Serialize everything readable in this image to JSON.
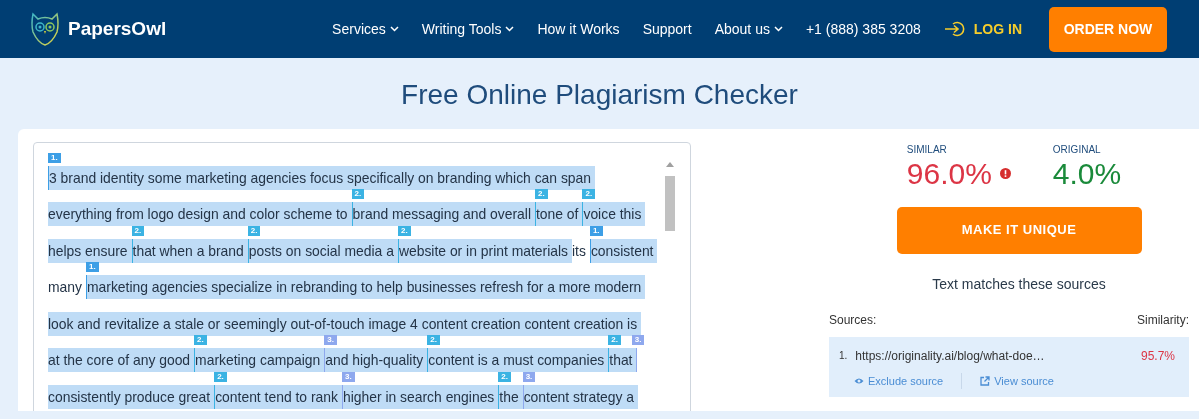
{
  "header": {
    "brand": "PapersOwl",
    "nav": [
      {
        "label": "Services",
        "dropdown": true
      },
      {
        "label": "Writing Tools",
        "dropdown": true
      },
      {
        "label": "How it Works",
        "dropdown": false
      },
      {
        "label": "Support",
        "dropdown": false
      },
      {
        "label": "About us",
        "dropdown": true
      },
      {
        "label": "+1 (888) 385 3208",
        "dropdown": false
      }
    ],
    "login": "LOG IN",
    "order": "ORDER NOW"
  },
  "title": "Free Online Plagiarism Checker",
  "editor": {
    "lines": [
      {
        "segments": [
          {
            "text": "3 brand identity some marketing agencies focus specifically on branding which can span",
            "highlighted": true,
            "markers": [
              {
                "label": "1.",
                "color": "#3d9fe6"
              }
            ]
          }
        ]
      },
      {
        "segments": [
          {
            "text": "everything from logo design and color scheme to",
            "highlighted": true
          },
          {
            "text": "brand messaging and overall",
            "highlighted": true,
            "markers": [
              {
                "label": "2.",
                "color": "#3bb3e3"
              }
            ]
          },
          {
            "text": "tone of",
            "highlighted": true,
            "markers": [
              {
                "label": "2.",
                "color": "#3bb3e3"
              }
            ]
          },
          {
            "text": "voice this",
            "highlighted": true,
            "markers": [
              {
                "label": "2.",
                "color": "#3bb3e3"
              }
            ]
          }
        ]
      },
      {
        "segments": [
          {
            "text": "helps ensure",
            "highlighted": true
          },
          {
            "text": "that when a brand",
            "highlighted": true,
            "markers": [
              {
                "label": "2.",
                "color": "#3bb3e3"
              }
            ]
          },
          {
            "text": "posts on social media a",
            "highlighted": true,
            "markers": [
              {
                "label": "2.",
                "color": "#3bb3e3"
              }
            ]
          },
          {
            "text": "website or in print materials",
            "highlighted": true,
            "markers": [
              {
                "label": "2.",
                "color": "#3bb3e3"
              }
            ]
          },
          {
            "text": "its",
            "highlighted": false
          },
          {
            "text": "consistent",
            "highlighted": true,
            "markers": [
              {
                "label": "1.",
                "color": "#3d9fe6"
              }
            ]
          }
        ]
      },
      {
        "segments": [
          {
            "text": "many",
            "highlighted": false
          },
          {
            "text": "marketing agencies specialize in rebranding to help businesses refresh for a more modern",
            "highlighted": true,
            "markers": [
              {
                "label": "1.",
                "color": "#3d9fe6"
              }
            ]
          }
        ]
      },
      {
        "segments": [
          {
            "text": "look and revitalize a stale or seemingly out-of-touch image 4 content creation content creation is",
            "highlighted": true
          }
        ]
      },
      {
        "segments": [
          {
            "text": "at the core of any good",
            "highlighted": true
          },
          {
            "text": "marketing campaign",
            "highlighted": true,
            "markers": [
              {
                "label": "2.",
                "color": "#3bb3e3"
              }
            ]
          },
          {
            "text": "and high-quality",
            "highlighted": true,
            "markers": [
              {
                "label": "3.",
                "color": "#8ea8ee"
              }
            ]
          },
          {
            "text": "content is a must companies",
            "highlighted": true,
            "markers": [
              {
                "label": "2.",
                "color": "#3bb3e3"
              }
            ]
          },
          {
            "text": "that",
            "highlighted": true,
            "markers": [
              {
                "label": "2.",
                "color": "#3bb3e3"
              },
              {
                "label": "3.",
                "color": "#8ea8ee"
              }
            ]
          }
        ]
      },
      {
        "segments": [
          {
            "text": "consistently produce great",
            "highlighted": true
          },
          {
            "text": "content tend to rank",
            "highlighted": true,
            "markers": [
              {
                "label": "2.",
                "color": "#3bb3e3"
              }
            ]
          },
          {
            "text": "higher in search engines",
            "highlighted": true,
            "markers": [
              {
                "label": "3.",
                "color": "#8ea8ee"
              }
            ]
          },
          {
            "text": "the",
            "highlighted": true,
            "markers": [
              {
                "label": "2.",
                "color": "#3bb3e3"
              }
            ]
          },
          {
            "text": "content strategy a",
            "highlighted": true,
            "markers": [
              {
                "label": "3.",
                "color": "#8ea8ee"
              }
            ]
          }
        ]
      }
    ]
  },
  "result": {
    "similar": {
      "label": "SIMILAR",
      "value": "96.0%"
    },
    "original": {
      "label": "ORIGINAL",
      "value": "4.0%"
    },
    "action": "MAKE IT UNIQUE",
    "matches_heading": "Text matches these sources",
    "sources_label": "Sources:",
    "similarity_label": "Similarity:",
    "sources": [
      {
        "index": "1.",
        "url": "https://originality.ai/blog/what-doe…",
        "similarity": "95.7%",
        "exclude": "Exclude source",
        "view": "View source"
      }
    ]
  }
}
